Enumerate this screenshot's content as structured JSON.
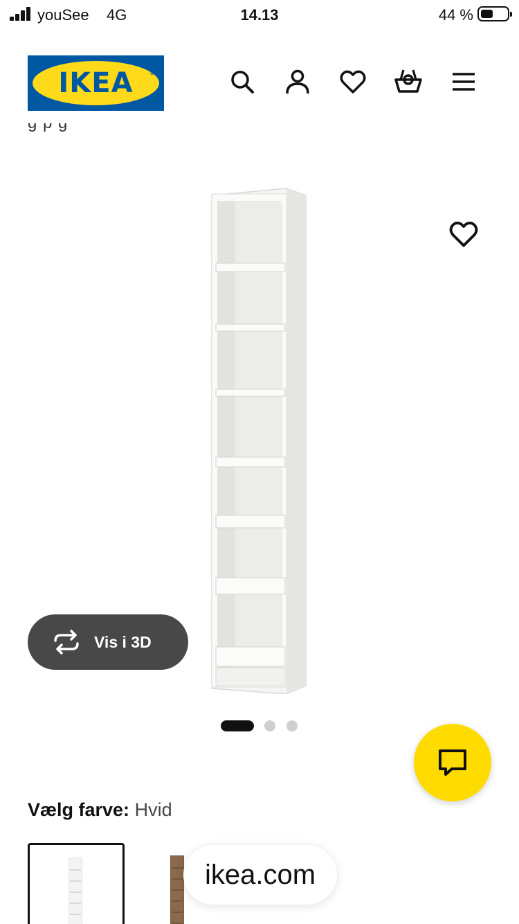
{
  "status_bar": {
    "carrier": "youSee",
    "network": "4G",
    "time": "14.13",
    "battery_percent": "44 %",
    "battery_level": 0.44
  },
  "header": {
    "logo_text": "IKEA",
    "icons": [
      "search-icon",
      "user-icon",
      "heart-icon",
      "basket-icon",
      "menu-icon"
    ]
  },
  "product": {
    "partial_text": "g p g",
    "view_3d_label": "Vis i 3D",
    "carousel": {
      "total": 3,
      "active_index": 0
    }
  },
  "color_picker": {
    "label": "Vælg farve:",
    "value": "Hvid",
    "options": [
      "white",
      "brown"
    ]
  },
  "browser": {
    "url": "ikea.com"
  },
  "colors": {
    "brand_blue": "#0058a3",
    "brand_yellow": "#ffda1a",
    "chat_yellow": "#ffdb00",
    "button_dark": "#484848"
  }
}
